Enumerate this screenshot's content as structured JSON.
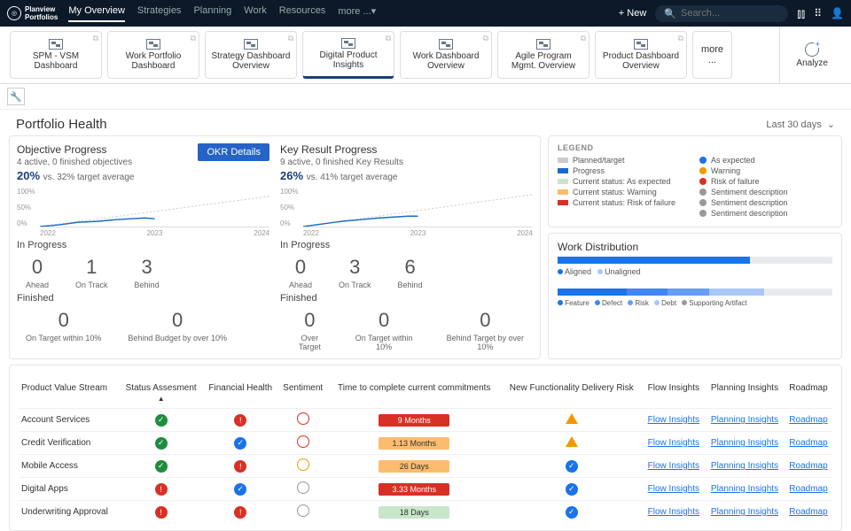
{
  "brand": {
    "l1": "Planview",
    "l2": "Portfolios"
  },
  "topnav": {
    "items": [
      "My Overview",
      "Strategies",
      "Planning",
      "Work",
      "Resources",
      "more ...▾"
    ],
    "active": 0
  },
  "topright": {
    "new": "+ New",
    "search_ph": "Search..."
  },
  "tabs": {
    "items": [
      "SPM - VSM Dashboard",
      "Work Portfolio Dashboard",
      "Strategy Dashboard Overview",
      "Digital Product Insights",
      "Work Dashboard Overview",
      "Agile Program Mgmt. Overview",
      "Product Dashboard Overview"
    ],
    "more": "more ...",
    "analyze": "Analyze",
    "active": 3
  },
  "section": {
    "title": "Portfolio Health",
    "range": "Last 30 days"
  },
  "obj": {
    "title": "Objective Progress",
    "sub": "4 active, 0 finished objectives",
    "pct": "20%",
    "vs": "vs. 32% target average",
    "okr": "OKR Details",
    "y": [
      "100%",
      "50%",
      "0%"
    ],
    "x": [
      "2022",
      "2023",
      "2024"
    ],
    "prog_lbl": "In Progress",
    "fin_lbl": "Finished",
    "prog": [
      {
        "n": "0",
        "l": "Ahead"
      },
      {
        "n": "1",
        "l": "On Track"
      },
      {
        "n": "3",
        "l": "Behind"
      }
    ],
    "fin": [
      {
        "n": "0",
        "l": "On Target within 10%"
      },
      {
        "n": "0",
        "l": "Behind Budget by over 10%"
      }
    ]
  },
  "kr": {
    "title": "Key Result Progress",
    "sub": "9 active, 0 finished Key Results",
    "pct": "26%",
    "vs": "vs. 41% target average",
    "y": [
      "100%",
      "50%",
      "0%"
    ],
    "x": [
      "2022",
      "2023",
      "2024"
    ],
    "prog_lbl": "In Progress",
    "fin_lbl": "Finished",
    "prog": [
      {
        "n": "0",
        "l": "Ahead"
      },
      {
        "n": "3",
        "l": "On Track"
      },
      {
        "n": "6",
        "l": "Behind"
      }
    ],
    "fin": [
      {
        "n": "0",
        "l": "Over Target"
      },
      {
        "n": "0",
        "l": "On Target within 10%"
      },
      {
        "n": "0",
        "l": "Behind Target by over 10%"
      }
    ]
  },
  "legend": {
    "title": "LEGEND",
    "left": [
      "Planned/target",
      "Progress",
      "Current status: As expected",
      "Current status: Warning",
      "Current status: Risk of failure"
    ],
    "right": [
      "As expected",
      "Warning",
      "Risk of failure",
      "Sentiment description",
      "Sentiment description",
      "Sentiment description"
    ]
  },
  "workdist": {
    "title": "Work Distribution",
    "row1": [
      "Aligned",
      "Unaligned"
    ],
    "row2": [
      "Feature",
      "Defect",
      "Risk",
      "Debt",
      "Supporting Artifact"
    ]
  },
  "table": {
    "h": [
      "Product Value Stream",
      "Status Assesment",
      "Financial Health",
      "Sentiment",
      "Time to complete current commitments",
      "New Functionality Delivery Risk",
      "Flow Insights",
      "Planning Insights",
      "Roadmap"
    ],
    "rows": [
      {
        "name": "Account Services",
        "sa": "g",
        "fh": "r",
        "se": "sad",
        "time": "9 Months",
        "tc": "red",
        "risk": "warn",
        "fi": "Flow Insights",
        "pi": "Planning Insights",
        "rm": "Roadmap"
      },
      {
        "name": "Credit Verification",
        "sa": "g",
        "fh": "b",
        "se": "sad",
        "time": "1.13 Months",
        "tc": "or",
        "risk": "warn",
        "fi": "Flow Insights",
        "pi": "Planning Insights",
        "rm": "Roadmap"
      },
      {
        "name": "Mobile Access",
        "sa": "g",
        "fh": "r",
        "se": "warn",
        "time": "26 Days",
        "tc": "or",
        "risk": "b",
        "fi": "Flow Insights",
        "pi": "Planning Insights",
        "rm": "Roadmap"
      },
      {
        "name": "Digital Apps",
        "sa": "r",
        "fh": "b",
        "se": "n",
        "time": "3.33 Months",
        "tc": "red",
        "risk": "b",
        "fi": "Flow Insights",
        "pi": "Planning Insights",
        "rm": "Roadmap"
      },
      {
        "name": "Underwriting Approval",
        "sa": "r",
        "fh": "r",
        "se": "n",
        "time": "18 Days",
        "tc": "gn",
        "risk": "b",
        "fi": "Flow Insights",
        "pi": "Planning Insights",
        "rm": "Roadmap"
      }
    ]
  },
  "chart_data": {
    "type": "line",
    "series": [
      {
        "name": "Objective Progress",
        "x": [
          2022,
          2022.5,
          2023,
          2023.3
        ],
        "y": [
          0,
          10,
          18,
          20
        ],
        "target": {
          "x": [
            2022,
            2024
          ],
          "y": [
            0,
            70
          ]
        }
      },
      {
        "name": "Key Result Progress",
        "x": [
          2022,
          2022.5,
          2023,
          2023.3
        ],
        "y": [
          0,
          12,
          22,
          26
        ],
        "target": {
          "x": [
            2022,
            2024
          ],
          "y": [
            0,
            80
          ]
        }
      }
    ],
    "ylim": [
      0,
      100
    ],
    "xlim": [
      2022,
      2024
    ],
    "ylabel": "%"
  }
}
